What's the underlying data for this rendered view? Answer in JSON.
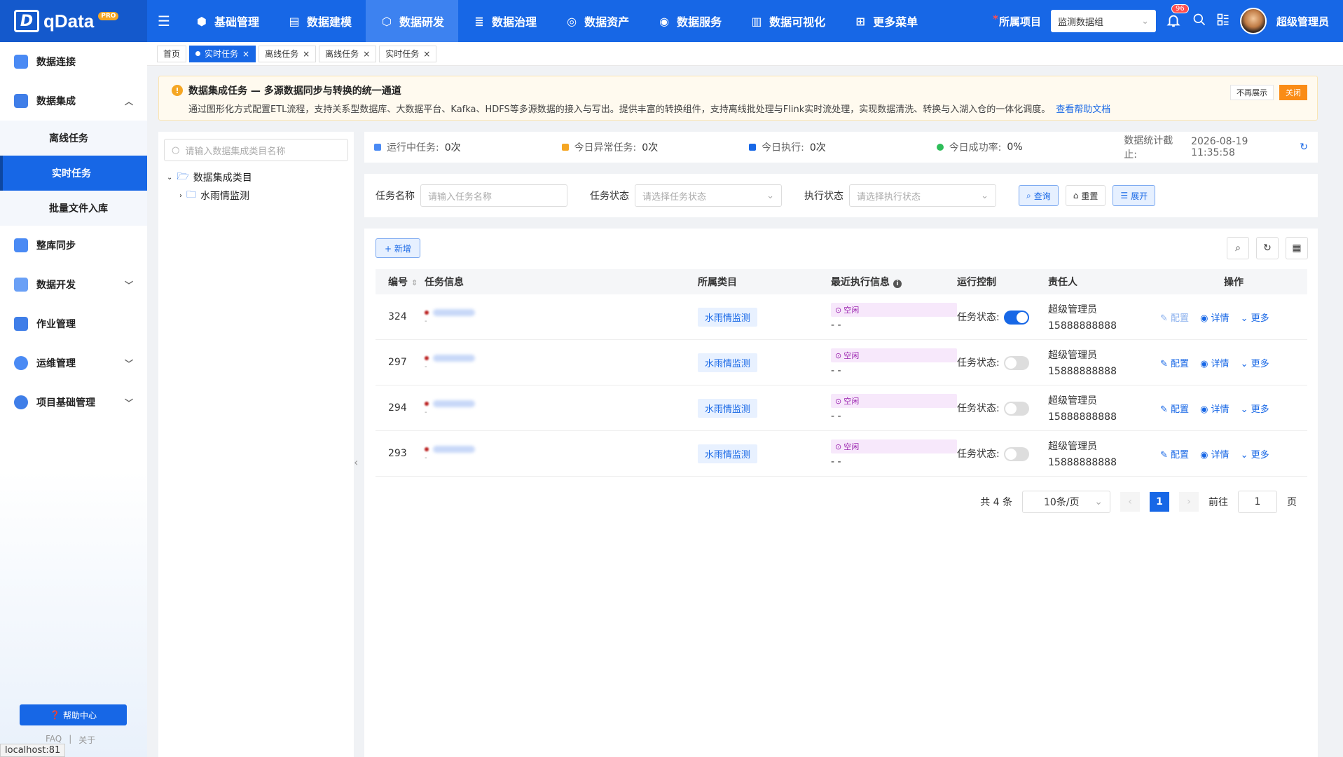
{
  "brand": {
    "name": "qData",
    "badge": "PRO"
  },
  "nav": [
    {
      "label": "基础管理",
      "icon": "cube-icon"
    },
    {
      "label": "数据建模",
      "icon": "book-icon"
    },
    {
      "label": "数据研发",
      "icon": "gear-cube-icon",
      "active": true
    },
    {
      "label": "数据治理",
      "icon": "database-icon"
    },
    {
      "label": "数据资产",
      "icon": "target-icon"
    },
    {
      "label": "数据服务",
      "icon": "service-icon"
    },
    {
      "label": "数据可视化",
      "icon": "chart-icon"
    },
    {
      "label": "更多菜单",
      "icon": "grid-plus-icon"
    }
  ],
  "header": {
    "project_label": "所属项目",
    "project_value": "监测数据组",
    "notify_count": "96",
    "user": "超级管理员"
  },
  "sidebar": {
    "items": [
      {
        "label": "数据连接"
      },
      {
        "label": "数据集成",
        "expanded": true
      },
      {
        "label": "整库同步"
      },
      {
        "label": "数据开发"
      },
      {
        "label": "作业管理"
      },
      {
        "label": "运维管理"
      },
      {
        "label": "项目基础管理"
      }
    ],
    "sub": [
      {
        "label": "离线任务"
      },
      {
        "label": "实时任务",
        "active": true
      },
      {
        "label": "批量文件入库"
      }
    ],
    "help": "帮助中心",
    "footer": [
      "FAQ",
      "关于"
    ]
  },
  "status_url": "localhost:81",
  "tabs": [
    {
      "label": "首页"
    },
    {
      "label": "实时任务",
      "active": true
    },
    {
      "label": "离线任务"
    },
    {
      "label": "离线任务"
    },
    {
      "label": "实时任务"
    }
  ],
  "notice": {
    "title": "数据集成任务 — 多源数据同步与转换的统一通道",
    "desc": "通过图形化方式配置ETL流程，支持关系型数据库、大数据平台、Kafka、HDFS等多源数据的接入与写出。提供丰富的转换组件，支持离线批处理与Flink实时流处理，实现数据清洗、转换与入湖入仓的一体化调度。",
    "link": "查看帮助文档",
    "hide": "不再展示",
    "close": "关闭"
  },
  "tree": {
    "placeholder": "请输入数据集成类目名称",
    "root": "数据集成类目",
    "child": "水雨情监测"
  },
  "stats": {
    "running_label": "运行中任务:",
    "running": "0次",
    "abnormal_label": "今日异常任务:",
    "abnormal": "0次",
    "exec_label": "今日执行:",
    "exec": "0次",
    "success_label": "今日成功率:",
    "success": "0%",
    "stamp_label": "数据统计截止:",
    "stamp": "2026-08-19 11:35:58"
  },
  "filters": {
    "name_label": "任务名称",
    "name_ph": "请输入任务名称",
    "status_label": "任务状态",
    "status_ph": "请选择任务状态",
    "exec_label": "执行状态",
    "exec_ph": "请选择执行状态",
    "query": "查询",
    "reset": "重置",
    "expand": "展开"
  },
  "table": {
    "add": "+ 新增",
    "headers": [
      "编号",
      "任务信息",
      "所属类目",
      "最近执行信息",
      "运行控制",
      "责任人",
      "操作"
    ],
    "rows": [
      {
        "id": "324",
        "category": "水雨情监测",
        "exec": "空闲",
        "exec_time": "- -",
        "ctl_label": "任务状态:",
        "on": true,
        "owner": "超级管理员",
        "phone": "15888888888",
        "info_sub": "-"
      },
      {
        "id": "297",
        "category": "水雨情监测",
        "exec": "空闲",
        "exec_time": "- -",
        "ctl_label": "任务状态:",
        "on": false,
        "owner": "超级管理员",
        "phone": "15888888888",
        "info_sub": "-"
      },
      {
        "id": "294",
        "category": "水雨情监测",
        "exec": "空闲",
        "exec_time": "- -",
        "ctl_label": "任务状态:",
        "on": false,
        "owner": "超级管理员",
        "phone": "15888888888",
        "info_sub": "-"
      },
      {
        "id": "293",
        "category": "水雨情监测",
        "exec": "空闲",
        "exec_time": "- -",
        "ctl_label": "任务状态:",
        "on": false,
        "owner": "超级管理员",
        "phone": "15888888888",
        "info_sub": "-"
      }
    ],
    "ops": {
      "config": "配置",
      "detail": "详情",
      "more": "更多"
    }
  },
  "pager": {
    "total": "共 4 条",
    "size": "10条/页",
    "current": "1",
    "goto": "前往",
    "goto_val": "1",
    "page": "页"
  },
  "colors": {
    "primary": "#1767e6",
    "topbar": "#1767e6",
    "idle": "#9c27b0",
    "warn": "#f5a623"
  }
}
